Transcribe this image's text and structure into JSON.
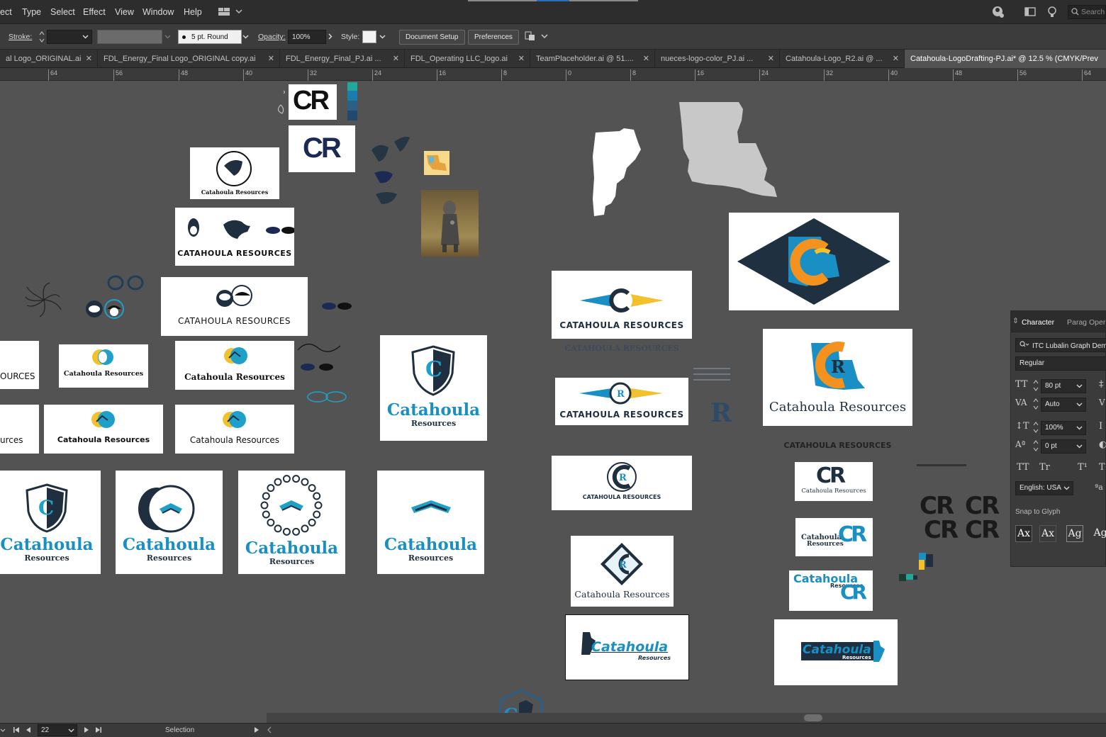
{
  "menubar": {
    "items": [
      "ect",
      "Type",
      "Select",
      "Effect",
      "View",
      "Window",
      "Help"
    ],
    "search_placeholder": "Search"
  },
  "control": {
    "stroke_label": "Stroke:",
    "brush": "5 pt. Round",
    "opacity_label": "Opacity:",
    "opacity_value": "100%",
    "style_label": "Style:",
    "doc_setup": "Document Setup",
    "preferences": "Preferences"
  },
  "tabs": [
    "al Logo_ORIGINAL.ai",
    "FDL_Energy_Final Logo_ORIGINAL copy.ai",
    "FDL_Energy_Final_PJ.ai ...",
    "FDL_Operating LLC_logo.ai",
    "TeamPlaceholder.ai @ 51....",
    "nueces-logo-color_PJ.ai ...",
    "Catahoula-Logo_R2.ai @ ...",
    "Catahoula-LogoDrafting-PJ.ai* @ 12.5 % (CMYK/Prev"
  ],
  "ruler_ticks": [
    "64",
    "56",
    "48",
    "40",
    "32",
    "24",
    "16",
    "8",
    "0",
    "8",
    "16",
    "24",
    "32",
    "40",
    "48",
    "56",
    "64"
  ],
  "artboards": {
    "cr_mark": "CR",
    "r_mark": "R",
    "catahoula_resources": "Catahoula Resources",
    "catahoula_resources_caps": "CATAHOULA RESOURCES",
    "catahoula": "Catahoula",
    "resources": "Resources",
    "ources_partial": "OURCES",
    "urces_partial": "urces",
    "catahoula_word": "Catahoula",
    "resources_word": "Resources"
  },
  "panel": {
    "tab_character": "Character",
    "tab_paragraph": "Parag",
    "tab_opentype": "Oper",
    "font_family": "ITC Lubalin Graph Dem",
    "font_style": "Regular",
    "font_size": "80 pt",
    "kerning": "Auto",
    "vscale": "100%",
    "baseline": "0 pt",
    "tt_caps": "TT",
    "tt_small": "Tr",
    "tt_super": "T¹",
    "tt_sub": "T₁",
    "language": "English: USA",
    "aa": "ªa",
    "snap_label": "Snap to Glyph"
  },
  "status": {
    "zoom_page": "22",
    "tool": "Selection"
  },
  "colors": {
    "navy": "#1f2f3f",
    "teal": "#1ea0c8",
    "yellow": "#f2c12e",
    "orange": "#f3921f",
    "dark_navy": "#1b2a52",
    "gray_state": "#c8c8c8"
  }
}
